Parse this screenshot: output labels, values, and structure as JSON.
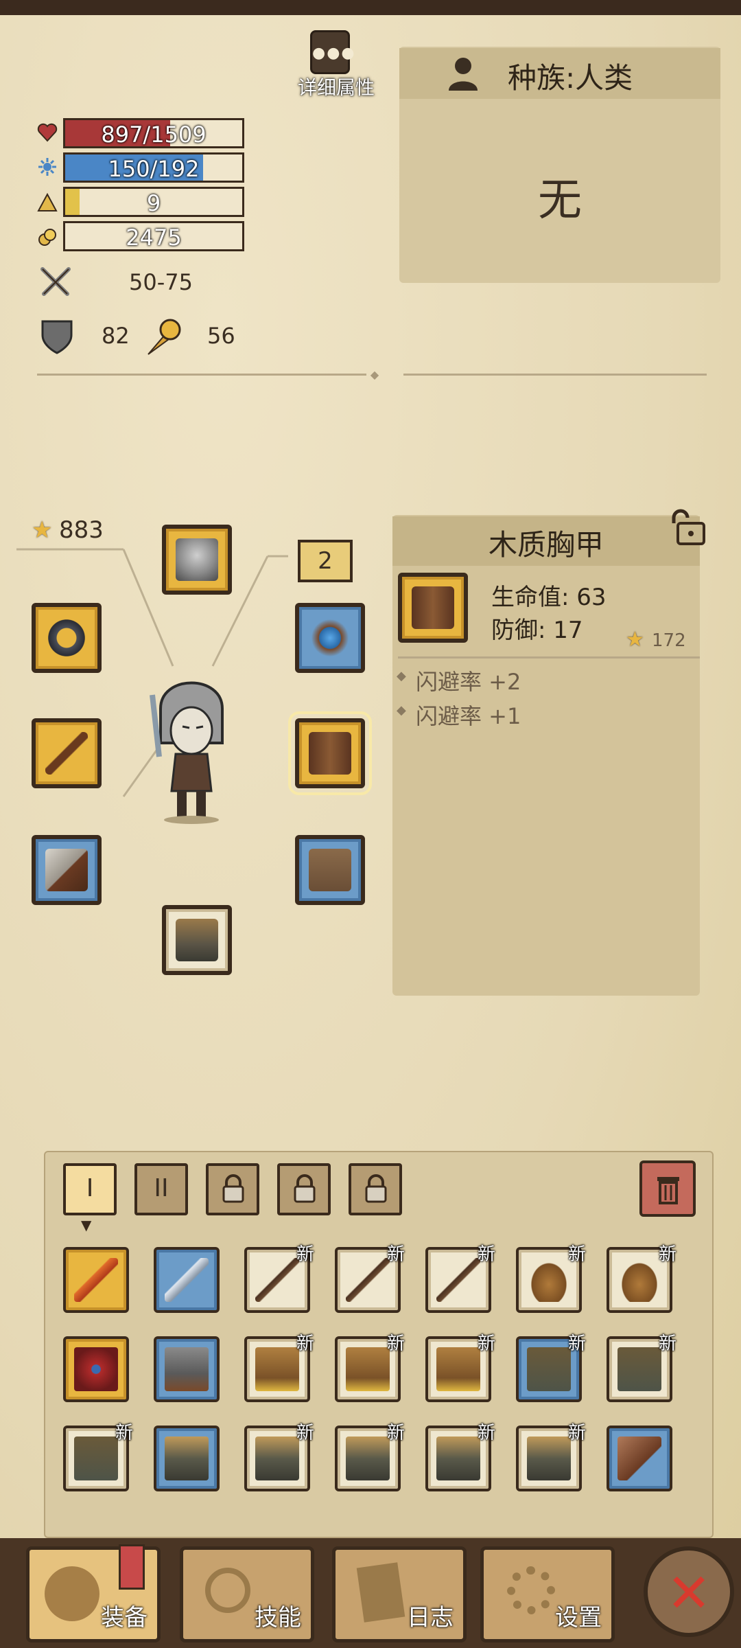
{
  "header": {
    "detail_button_label": "详细属性",
    "race_label": "种族:人类",
    "race_trait": "无"
  },
  "stats": {
    "hp": {
      "text": "897/1509",
      "fraction": 0.594,
      "color": "#a83838",
      "icon": "heart-icon"
    },
    "mana": {
      "text": "150/192",
      "fraction": 0.781,
      "color": "#4a86c6",
      "icon": "mana-icon"
    },
    "level": {
      "text": "9",
      "fraction": 0.08,
      "color": "#e2c24a",
      "icon": "triangle-icon"
    },
    "gold": {
      "text": "2475",
      "fraction": 0,
      "color": "#d8c28a",
      "icon": "coin-icon"
    },
    "attack": "50-75",
    "armor": "82",
    "magic_resist": "56"
  },
  "equipment": {
    "power_score": "883",
    "level_badge": "2",
    "slots": [
      {
        "name": "helmet-slot",
        "rarity": "gold"
      },
      {
        "name": "ring-slot",
        "rarity": "gold"
      },
      {
        "name": "amulet-slot",
        "rarity": "blue"
      },
      {
        "name": "weapon-slot",
        "rarity": "gold"
      },
      {
        "name": "chest-slot",
        "rarity": "gold"
      },
      {
        "name": "gloves-slot",
        "rarity": "blue"
      },
      {
        "name": "pants-slot",
        "rarity": "blue"
      },
      {
        "name": "boots-slot",
        "rarity": "plain"
      }
    ]
  },
  "item_detail": {
    "title": "木质胸甲",
    "stat1": "生命值: 63",
    "stat2": "防御: 17",
    "score": "172",
    "affix1": "闪避率 +2",
    "affix2": "闪避率 +1"
  },
  "inventory": {
    "tabs": [
      "I",
      "II",
      "lock",
      "lock",
      "lock"
    ],
    "new_label": "新",
    "rows": [
      [
        {
          "kind": "dagger",
          "rarity": "gold",
          "is_new": false
        },
        {
          "kind": "sword",
          "rarity": "blue",
          "is_new": false
        },
        {
          "kind": "spear",
          "rarity": "plain",
          "is_new": true
        },
        {
          "kind": "spear",
          "rarity": "plain",
          "is_new": true
        },
        {
          "kind": "spear",
          "rarity": "plain",
          "is_new": true
        },
        {
          "kind": "helmet",
          "rarity": "plain",
          "is_new": true
        },
        {
          "kind": "helmet",
          "rarity": "plain",
          "is_new": true
        }
      ],
      [
        {
          "kind": "red-armor",
          "rarity": "gold",
          "is_new": false
        },
        {
          "kind": "chainmail",
          "rarity": "blue",
          "is_new": false
        },
        {
          "kind": "leather-armor",
          "rarity": "plain",
          "is_new": true
        },
        {
          "kind": "leather-armor",
          "rarity": "plain",
          "is_new": true
        },
        {
          "kind": "leather-armor",
          "rarity": "plain",
          "is_new": true
        },
        {
          "kind": "pants",
          "rarity": "blue",
          "is_new": true
        },
        {
          "kind": "pants",
          "rarity": "plain",
          "is_new": true
        }
      ],
      [
        {
          "kind": "pants",
          "rarity": "plain",
          "is_new": true
        },
        {
          "kind": "boots",
          "rarity": "blue",
          "is_new": false
        },
        {
          "kind": "boots",
          "rarity": "plain",
          "is_new": true
        },
        {
          "kind": "boots",
          "rarity": "plain",
          "is_new": true
        },
        {
          "kind": "boots",
          "rarity": "plain",
          "is_new": true
        },
        {
          "kind": "boots",
          "rarity": "plain",
          "is_new": true
        },
        {
          "kind": "gloves",
          "rarity": "blue",
          "is_new": false
        }
      ]
    ]
  },
  "nav": {
    "equip": "装备",
    "skills": "技能",
    "log": "日志",
    "settings": "设置"
  }
}
